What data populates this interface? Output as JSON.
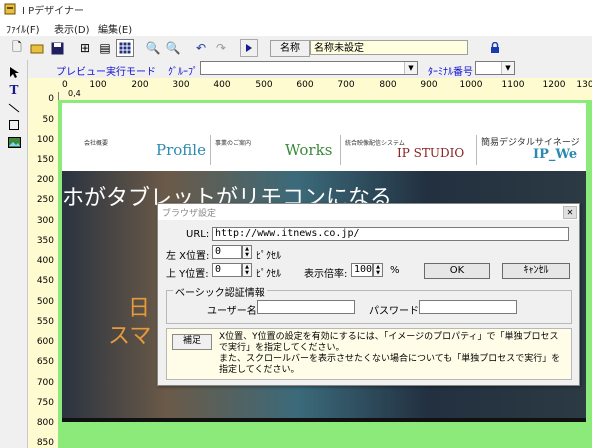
{
  "app": {
    "title": "I Pデザイナー"
  },
  "menu": [
    "ﾌｧｲﾙ(F)",
    "表示(D)",
    "編集(E)"
  ],
  "toolbar": {
    "icons": [
      "new-file-icon",
      "open-folder-icon",
      "save-icon",
      "tree-icon",
      "properties-icon",
      "grid-icon",
      "zoom-in-icon",
      "zoom-out-icon",
      "undo-icon",
      "redo-icon",
      "play-icon"
    ],
    "name_label": "名称",
    "name_value": "名称未設定",
    "lock_icon": "lock-icon"
  },
  "tools": [
    "pointer-tool-icon",
    "text-tool-icon",
    "line-tool-icon",
    "rect-tool-icon",
    "image-tool-icon"
  ],
  "previewbar": {
    "preview_mode": "プレビュー実行モード",
    "group_label": "ｸﾞﾙｰﾌﾟ",
    "group_value": "",
    "terminal_label": "ﾀｰﾐﾅﾙ番号",
    "terminal_value": ""
  },
  "ruler": {
    "origin": "0",
    "h": [
      "100",
      "200",
      "300",
      "400",
      "500",
      "600",
      "700",
      "800",
      "900",
      "1000",
      "1100",
      "1200",
      "130"
    ],
    "h_small": "0,4",
    "v": [
      "0",
      "50",
      "100",
      "150",
      "200",
      "250",
      "300",
      "350",
      "400",
      "450",
      "500",
      "550",
      "600",
      "650",
      "700",
      "750",
      "800",
      "850"
    ]
  },
  "webpage": {
    "nav": [
      {
        "small": "会社概要",
        "big": "Profile",
        "color": "#2a8ab0"
      },
      {
        "small": "事業のご案内",
        "big": "Works",
        "color": "#3c8a3c"
      },
      {
        "small": "統合映像配信システム",
        "big": "IP STUDIO",
        "color": "#8a2020"
      },
      {
        "small": "簡易デジタルサイネージ",
        "big": "IP_We",
        "color": "#2a8ab0"
      }
    ],
    "hero_line1": "ホがタブレットがリモコンになる",
    "hero_line2": "日",
    "hero_line3": "スマ"
  },
  "dialog": {
    "title": "ブラウザ設定",
    "url_label": "URL:",
    "url_value": "http://www.itnews.co.jp/",
    "left_x_label": "左 X位置:",
    "left_x_value": "0",
    "top_y_label": "上 Y位置:",
    "top_y_value": "0",
    "pixel_unit": "ﾋﾟｸｾﾙ",
    "zoom_label": "表示倍率:",
    "zoom_value": "100",
    "percent": "%",
    "ok": "OK",
    "cancel": "ｷｬﾝｾﾙ",
    "basic_auth": "ベーシック認証情報",
    "user_label": "ユーザー名:",
    "user_value": "",
    "password_label": "パスワード:",
    "password_value": "",
    "note_button": "補足",
    "note_text": "X位置、Y位置の設定を有効にするには、「イメージのプロパティ」で「単独プロセスで実行」を指定してください。\nまた、スクロールバーを表示させたくない場合についても「単独プロセスで実行」を指定してください。"
  }
}
